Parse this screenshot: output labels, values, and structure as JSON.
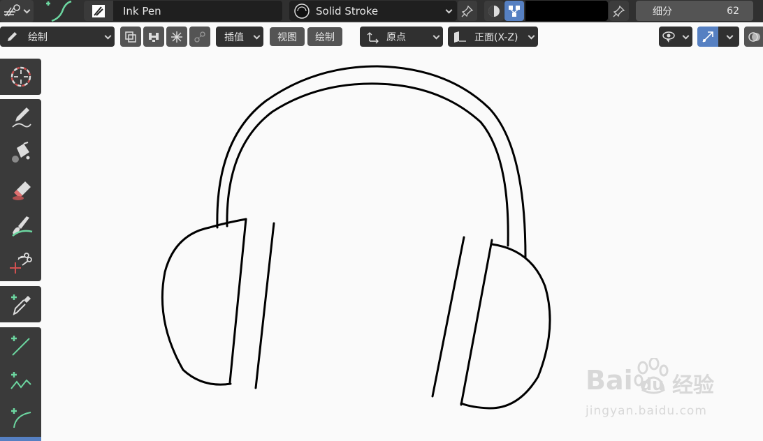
{
  "topbar": {
    "brush_name": "Ink Pen",
    "material_name": "Solid Stroke",
    "subdivide_label": "细分",
    "subdivide_value": "62",
    "color_swatch": "#000000"
  },
  "toolbar": {
    "mode_label": "绘制",
    "interpolate_label": "插值",
    "view_label": "视图",
    "draw_label": "绘制",
    "origin_label": "原点",
    "plane_label": "正面(X-Z)"
  },
  "tools": [
    {
      "name": "cursor-tool"
    },
    {
      "name": "draw-tool"
    },
    {
      "name": "fill-tool"
    },
    {
      "name": "erase-tool"
    },
    {
      "name": "tint-tool"
    },
    {
      "name": "cutter-tool"
    },
    {
      "name": "eyedropper-tool"
    },
    {
      "name": "line-tool"
    },
    {
      "name": "polyline-tool"
    },
    {
      "name": "arc-tool"
    }
  ],
  "watermark": {
    "brand": "Bai",
    "brand2": "du",
    "brand_cn": "经验",
    "url": "jingyan.baidu.com"
  },
  "colors": {
    "accent": "#5680c2",
    "panel": "#303030",
    "canvas": "#fafafa"
  }
}
